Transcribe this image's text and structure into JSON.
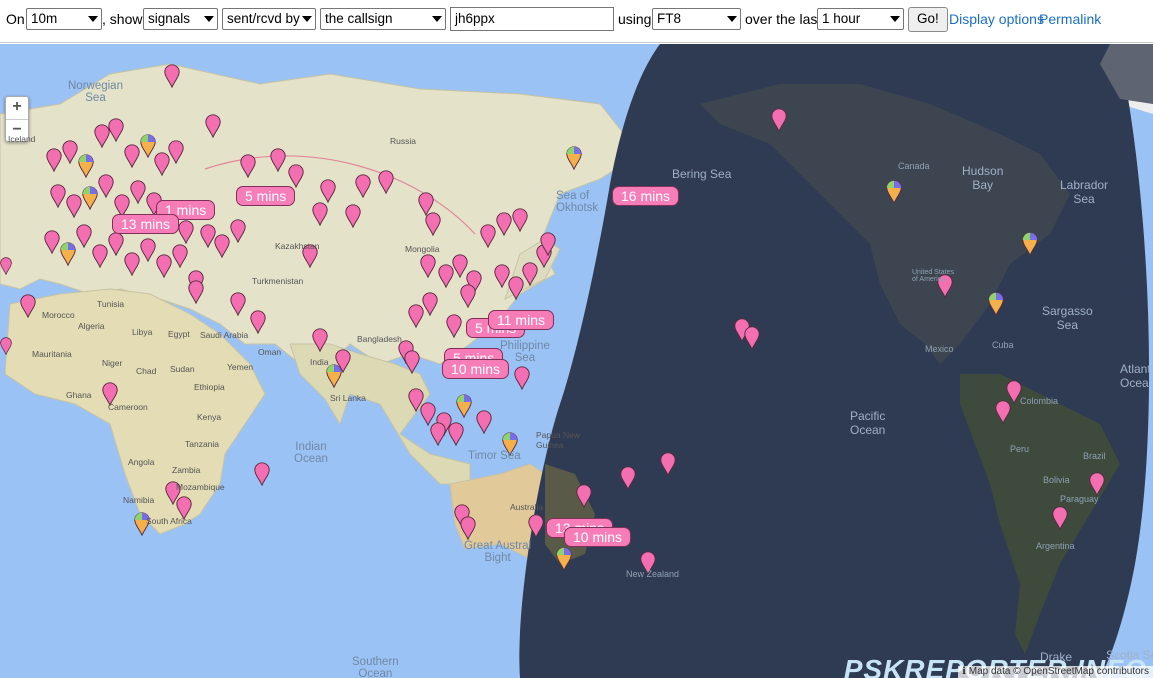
{
  "toolbar": {
    "on_label": "On",
    "band": "10m",
    "show_label": ", show",
    "show_type": "signals",
    "direction": "sent/rcvd by",
    "target": "the callsign",
    "callsign": "jh6ppx",
    "using_label": "using",
    "mode": "FT8",
    "period_label": "over the last",
    "period": "1 hour",
    "go_label": "Go!",
    "display_options_label": "Display options",
    "permalink_label": "Permalink"
  },
  "map": {
    "zoom_in": "+",
    "zoom_out": "−",
    "labels": {
      "norwegian_sea": "Norwegian\nSea",
      "iceland": "Iceland",
      "russia": "Russia",
      "kazakhstan": "Kazakhstan",
      "mongolia": "Mongolia",
      "turkmenistan": "Turkmenistan",
      "tunisia": "Tunisia",
      "algeria": "Algeria",
      "libya": "Libya",
      "egypt": "Egypt",
      "saudi_arabia": "Saudi Arabia",
      "oman": "Oman",
      "yemen": "Yemen",
      "morocco": "Morocco",
      "mauritania": "Mauritania",
      "niger": "Niger",
      "chad": "Chad",
      "sudan": "Sudan",
      "ethiopia": "Ethiopia",
      "kenya": "Kenya",
      "ghana": "Ghana",
      "angola": "Angola",
      "zambia": "Zambia",
      "namibia": "Namibia",
      "mozambique": "Mozambique",
      "south_africa": "South Africa",
      "tanzania": "Tanzania",
      "cameroon": "Cameroon",
      "india": "India",
      "sri_lanka": "Sri Lanka",
      "bangladesh": "Bangladesh",
      "indian_ocean": "Indian\nOcean",
      "philippine_sea": "Philippine\nSea",
      "sea_of_okhotsk": "Sea of\nOkhotsk",
      "bering_sea": "Bering Sea",
      "timor_sea": "Timor Sea",
      "papua_new_guinea": "Papua New\nGuinea",
      "australia": "Australia",
      "great_australian_bight": "Great Austral\nBight",
      "new_zealand": "New Zealand",
      "pacific_ocean": "Pacific\nOcean",
      "canada": "Canada",
      "hudson_bay": "Hudson\nBay",
      "labrador_sea": "Labrador\nSea",
      "sargasso_sea": "Sargasso\nSea",
      "united_states": "United States\nof America",
      "mexico": "Mexico",
      "cuba": "Cuba",
      "colombia": "Colombia",
      "peru": "Peru",
      "brazil": "Brazil",
      "bolivia": "Bolivia",
      "paraguay": "Paraguay",
      "argentina": "Argentina",
      "atlantic_ocean": "Atlant\nOcea",
      "southern_ocean": "Southern\nOcean",
      "scotia_sea": "Scotia Se",
      "drake": "Drake"
    },
    "bubbles": [
      {
        "label": "5 mins"
      },
      {
        "label": "1 mins"
      },
      {
        "label": "13 mins"
      },
      {
        "label": "16 mins"
      },
      {
        "label": "5 mins"
      },
      {
        "label": "11 mins"
      },
      {
        "label": "5 mins"
      },
      {
        "label": "10 mins"
      },
      {
        "label": "13 mins"
      },
      {
        "label": "10 mins"
      }
    ],
    "brand": "PSKREPORTER.INFO",
    "attribution": "ℹ Map data © OpenStreetMap contributors"
  },
  "colors": {
    "ocean": "#9bc2f5",
    "land": "#e4e2c8",
    "night": "#2f3b52",
    "marker": "#f36fb2",
    "marker_stroke": "#5a2a40",
    "bubble": "#f77db8",
    "link": "#1a6fc4"
  }
}
